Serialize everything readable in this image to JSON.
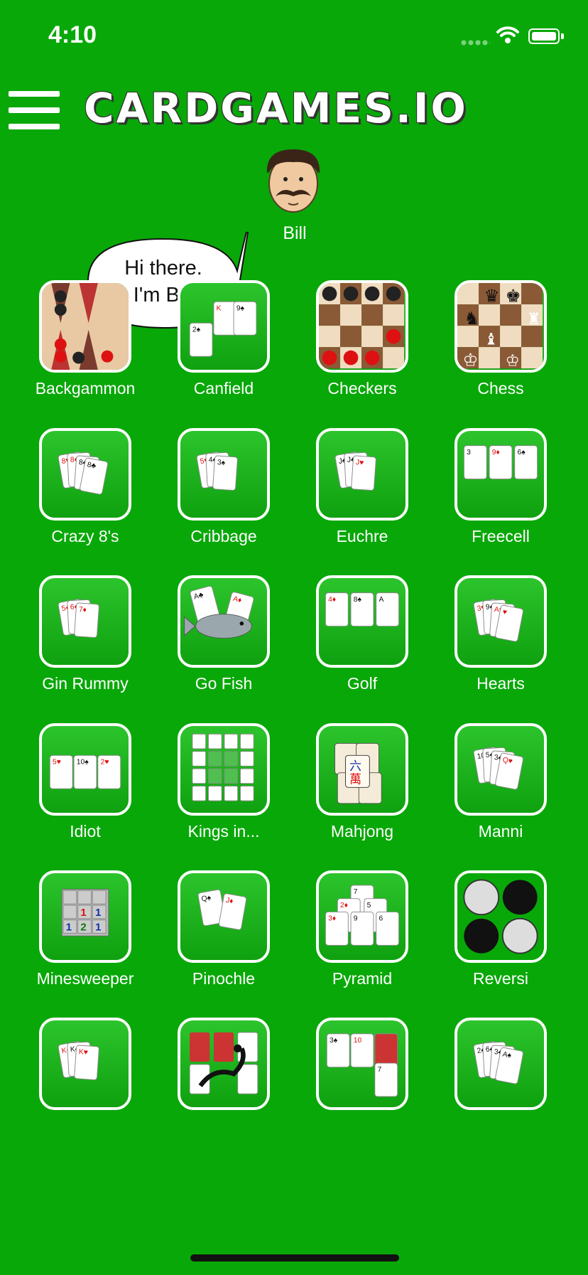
{
  "status": {
    "time": "4:10"
  },
  "header": {
    "logo": "CARDGAMES.IO"
  },
  "mascot": {
    "name": "Bill",
    "speech_line1": "Hi there.",
    "speech_line2": "I'm Bill"
  },
  "games": [
    {
      "label": "Backgammon",
      "icon": "backgammon-icon"
    },
    {
      "label": "Canfield",
      "icon": "canfield-icon"
    },
    {
      "label": "Checkers",
      "icon": "checkers-icon"
    },
    {
      "label": "Chess",
      "icon": "chess-icon"
    },
    {
      "label": "Crazy 8's",
      "icon": "crazy-eights-icon"
    },
    {
      "label": "Cribbage",
      "icon": "cribbage-icon"
    },
    {
      "label": "Euchre",
      "icon": "euchre-icon"
    },
    {
      "label": "Freecell",
      "icon": "freecell-icon"
    },
    {
      "label": "Gin Rummy",
      "icon": "gin-rummy-icon"
    },
    {
      "label": "Go Fish",
      "icon": "go-fish-icon"
    },
    {
      "label": "Golf",
      "icon": "golf-icon"
    },
    {
      "label": "Hearts",
      "icon": "hearts-icon"
    },
    {
      "label": "Idiot",
      "icon": "idiot-icon"
    },
    {
      "label": "Kings in...",
      "icon": "kings-in-the-corner-icon"
    },
    {
      "label": "Mahjong",
      "icon": "mahjong-icon"
    },
    {
      "label": "Manni",
      "icon": "manni-icon"
    },
    {
      "label": "Minesweeper",
      "icon": "minesweeper-icon"
    },
    {
      "label": "Pinochle",
      "icon": "pinochle-icon"
    },
    {
      "label": "Pyramid",
      "icon": "pyramid-icon"
    },
    {
      "label": "Reversi",
      "icon": "reversi-icon"
    },
    {
      "label": "",
      "icon": "kings-cards-icon"
    },
    {
      "label": "",
      "icon": "scorpion-icon"
    },
    {
      "label": "",
      "icon": "solitaire-icon"
    },
    {
      "label": "",
      "icon": "spades-icon"
    }
  ],
  "colors": {
    "background": "#08a808",
    "tile": "#1fb51f",
    "border": "#ffffff"
  }
}
